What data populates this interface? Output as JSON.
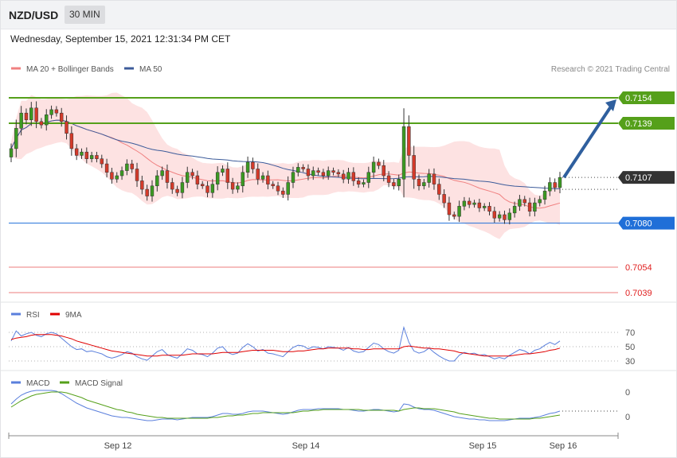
{
  "header": {
    "pair": "NZD/USD",
    "interval": "30 MIN",
    "timestamp": "Wednesday, September 15, 2021 12:31:34 PM CET"
  },
  "legend": {
    "ma20": "MA 20 + Bollinger Bands",
    "ma50": "MA 50",
    "copyright": "Research © 2021 Trading Central"
  },
  "colors": {
    "resistance": "#55a01a",
    "support": "#1f6fd8",
    "target": "#e02020",
    "current": "#333333",
    "bull_candle": "#3b9a22",
    "bear_candle": "#d43a2a",
    "bollinger_fill": "#fde2e2",
    "ma20": "#f08080",
    "ma50": "#3c5b9a",
    "arrow": "#2f5f9e",
    "rsi": "#5a7fdc",
    "rsi_ma": "#e00000",
    "macd": "#5a7fdc",
    "macd_signal": "#55a01a"
  },
  "chart_data": {
    "type": "candlestick",
    "x_tick_labels": [
      "Sep 12",
      "Sep 14",
      "Sep 15",
      "Sep 16"
    ],
    "levels": {
      "resistance": [
        "0.7154",
        "0.7139"
      ],
      "current": "0.7107",
      "support": "0.7080",
      "targets": [
        "0.7054",
        "0.7039"
      ]
    },
    "closes": [
      0.7124,
      0.7136,
      0.7145,
      0.7141,
      0.7148,
      0.714,
      0.7138,
      0.7144,
      0.7147,
      0.7145,
      0.714,
      0.7133,
      0.7124,
      0.712,
      0.7122,
      0.7118,
      0.712,
      0.7118,
      0.7115,
      0.711,
      0.7106,
      0.7108,
      0.7111,
      0.7115,
      0.7112,
      0.7105,
      0.71,
      0.7096,
      0.7102,
      0.7108,
      0.7111,
      0.7104,
      0.71,
      0.7098,
      0.7104,
      0.711,
      0.7108,
      0.7103,
      0.7102,
      0.7098,
      0.7103,
      0.711,
      0.7112,
      0.7104,
      0.71,
      0.7102,
      0.711,
      0.7116,
      0.7112,
      0.7106,
      0.7108,
      0.7103,
      0.7102,
      0.7099,
      0.7097,
      0.7104,
      0.711,
      0.7113,
      0.7112,
      0.7108,
      0.7111,
      0.711,
      0.7108,
      0.7111,
      0.711,
      0.7109,
      0.7106,
      0.711,
      0.7105,
      0.7103,
      0.7104,
      0.711,
      0.7116,
      0.7114,
      0.7108,
      0.7104,
      0.7102,
      0.7106,
      0.7137,
      0.712,
      0.7106,
      0.7102,
      0.7104,
      0.7109,
      0.7103,
      0.7097,
      0.7092,
      0.7085,
      0.7084,
      0.709,
      0.7093,
      0.7091,
      0.7092,
      0.7089,
      0.709,
      0.7087,
      0.7083,
      0.7085,
      0.7082,
      0.7086,
      0.709,
      0.7094,
      0.7092,
      0.7087,
      0.7092,
      0.7094,
      0.7099,
      0.7104,
      0.7101,
      0.7107
    ],
    "rsi": {
      "ticks": [
        70,
        50,
        30
      ],
      "series": [
        {
          "name": "RSI",
          "values": [
            58,
            72,
            65,
            68,
            70,
            66,
            64,
            68,
            70,
            68,
            62,
            56,
            50,
            46,
            47,
            43,
            44,
            42,
            40,
            36,
            34,
            36,
            39,
            43,
            41,
            36,
            33,
            31,
            37,
            43,
            46,
            39,
            36,
            34,
            40,
            47,
            45,
            40,
            39,
            36,
            41,
            48,
            50,
            42,
            39,
            41,
            49,
            54,
            50,
            44,
            46,
            41,
            40,
            38,
            36,
            43,
            49,
            52,
            51,
            47,
            50,
            49,
            47,
            50,
            49,
            48,
            45,
            49,
            44,
            42,
            43,
            49,
            55,
            53,
            47,
            43,
            41,
            45,
            77,
            56,
            44,
            41,
            43,
            48,
            42,
            37,
            33,
            30,
            30,
            38,
            42,
            40,
            41,
            38,
            39,
            36,
            33,
            35,
            33,
            38,
            42,
            46,
            44,
            40,
            45,
            47,
            52,
            56,
            53,
            58
          ]
        },
        {
          "name": "9MA",
          "values": [
            60,
            62,
            63,
            64,
            66,
            67,
            67,
            67,
            67,
            66,
            65,
            63,
            61,
            58,
            56,
            54,
            52,
            50,
            48,
            46,
            44,
            43,
            42,
            41,
            40,
            39,
            38,
            37,
            37,
            37,
            38,
            38,
            38,
            38,
            38,
            39,
            40,
            40,
            40,
            40,
            40,
            41,
            42,
            42,
            42,
            42,
            43,
            44,
            45,
            45,
            45,
            45,
            45,
            44,
            43,
            43,
            43,
            44,
            44,
            45,
            46,
            47,
            47,
            48,
            48,
            48,
            48,
            48,
            47,
            47,
            46,
            46,
            47,
            47,
            47,
            47,
            47,
            47,
            50,
            51,
            50,
            49,
            48,
            48,
            47,
            47,
            46,
            45,
            44,
            42,
            41,
            40,
            39,
            38,
            37,
            37,
            37,
            37,
            37,
            37,
            38,
            39,
            40,
            40,
            41,
            42,
            43,
            45,
            46,
            48
          ]
        }
      ]
    },
    "macd": {
      "ticks": [
        0,
        0
      ],
      "series": [
        {
          "name": "MACD",
          "values": [
            0.9,
            1.5,
            2.0,
            2.3,
            2.5,
            2.6,
            2.6,
            2.6,
            2.6,
            2.5,
            2.2,
            1.8,
            1.4,
            1.0,
            0.7,
            0.4,
            0.2,
            0.0,
            -0.2,
            -0.4,
            -0.6,
            -0.7,
            -0.8,
            -0.8,
            -0.9,
            -1.0,
            -1.1,
            -1.2,
            -1.2,
            -1.1,
            -1.0,
            -1.0,
            -1.0,
            -1.1,
            -1.0,
            -0.9,
            -0.8,
            -0.8,
            -0.8,
            -0.8,
            -0.7,
            -0.5,
            -0.3,
            -0.3,
            -0.4,
            -0.4,
            -0.3,
            -0.1,
            0.0,
            0.0,
            0.0,
            -0.1,
            -0.2,
            -0.3,
            -0.4,
            -0.3,
            -0.1,
            0.1,
            0.2,
            0.2,
            0.2,
            0.3,
            0.3,
            0.3,
            0.3,
            0.3,
            0.2,
            0.2,
            0.1,
            0.0,
            0.0,
            0.1,
            0.2,
            0.2,
            0.1,
            0.0,
            -0.1,
            0.0,
            0.9,
            0.8,
            0.5,
            0.3,
            0.2,
            0.2,
            0.1,
            -0.1,
            -0.3,
            -0.5,
            -0.7,
            -0.8,
            -0.9,
            -1.0,
            -1.0,
            -1.1,
            -1.1,
            -1.2,
            -1.2,
            -1.2,
            -1.2,
            -1.1,
            -1.0,
            -0.9,
            -0.9,
            -0.9,
            -0.8,
            -0.7,
            -0.5,
            -0.3,
            -0.2,
            0.0
          ]
        },
        {
          "name": "MACD Signal",
          "values": [
            0.5,
            0.9,
            1.3,
            1.6,
            1.9,
            2.1,
            2.2,
            2.3,
            2.4,
            2.4,
            2.4,
            2.3,
            2.1,
            1.9,
            1.7,
            1.4,
            1.2,
            1.0,
            0.8,
            0.6,
            0.4,
            0.2,
            0.1,
            -0.1,
            -0.2,
            -0.4,
            -0.5,
            -0.6,
            -0.7,
            -0.8,
            -0.8,
            -0.9,
            -0.9,
            -0.9,
            -0.9,
            -0.9,
            -0.9,
            -0.9,
            -0.9,
            -0.9,
            -0.8,
            -0.8,
            -0.7,
            -0.6,
            -0.6,
            -0.5,
            -0.5,
            -0.4,
            -0.3,
            -0.3,
            -0.2,
            -0.2,
            -0.2,
            -0.2,
            -0.2,
            -0.2,
            -0.2,
            -0.1,
            0.0,
            0.0,
            0.1,
            0.1,
            0.2,
            0.2,
            0.2,
            0.2,
            0.2,
            0.2,
            0.2,
            0.2,
            0.1,
            0.1,
            0.1,
            0.1,
            0.1,
            0.1,
            0.1,
            0.0,
            0.2,
            0.3,
            0.4,
            0.4,
            0.3,
            0.3,
            0.3,
            0.2,
            0.1,
            0.0,
            -0.1,
            -0.3,
            -0.4,
            -0.5,
            -0.6,
            -0.7,
            -0.8,
            -0.9,
            -0.9,
            -1.0,
            -1.0,
            -1.0,
            -1.0,
            -1.0,
            -1.0,
            -1.0,
            -0.9,
            -0.9,
            -0.8,
            -0.7,
            -0.6,
            -0.5
          ]
        }
      ]
    }
  }
}
